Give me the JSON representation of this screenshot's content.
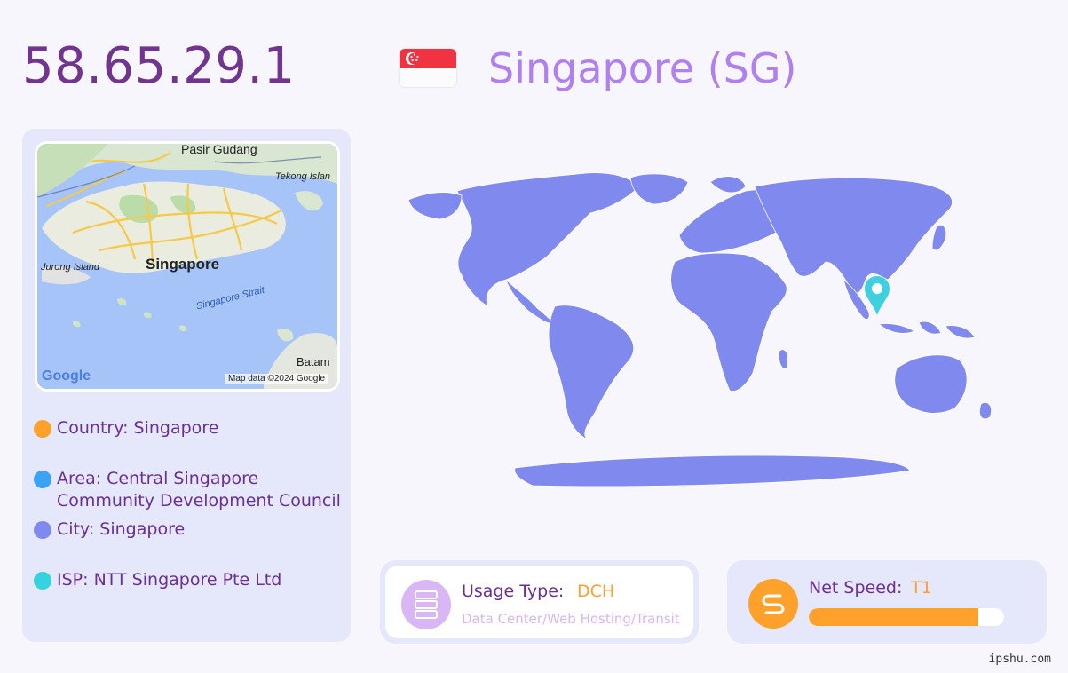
{
  "header": {
    "ip": "58.65.29.1",
    "country_title": "Singapore (SG)"
  },
  "mini_map": {
    "labels": {
      "pasir_gudang": "Pasir Gudang",
      "tekong": "Tekong Islan",
      "jurong": "Jurong Island",
      "singapore": "Singapore",
      "strait": "Singapore Strait",
      "batam": "Batam",
      "google": "Google",
      "attribution": "Map data ©2024 Google"
    }
  },
  "info": {
    "country": "Country: Singapore",
    "area": "Area: Central Singapore Community Development Council",
    "city": "City: Singapore",
    "isp": "ISP: NTT Singapore Pte Ltd"
  },
  "usage": {
    "label": "Usage Type:",
    "value": "DCH",
    "description": "Data Center/Web Hosting/Transit"
  },
  "speed": {
    "label": "Net Speed:",
    "value": "T1",
    "level_percent": 87
  },
  "watermark": "ipshu.com",
  "colors": {
    "accent_purple": "#71358f",
    "title_lilac": "#b07ff0",
    "panel_bg": "#e5e7fb",
    "map_fill": "#8089ee",
    "orange": "#ffa12b",
    "dot_country": "#ffa12b",
    "dot_area": "#3aa3f5",
    "dot_city": "#8089ee",
    "dot_isp": "#35d3e0",
    "pin": "#3fd0e0"
  },
  "icons": [
    "singapore-flag-icon",
    "server-icon",
    "speed-icon",
    "location-pin-icon"
  ]
}
